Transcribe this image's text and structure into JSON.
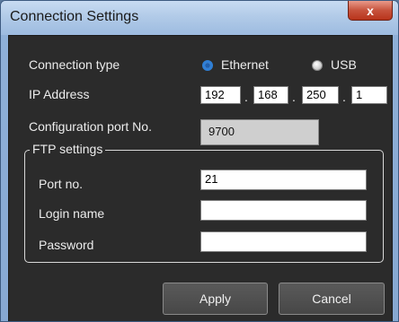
{
  "window": {
    "title": "Connection Settings",
    "close_glyph": "x"
  },
  "connection": {
    "label": "Connection type",
    "options": [
      {
        "label": "Ethernet",
        "selected": true
      },
      {
        "label": "USB",
        "selected": false
      }
    ]
  },
  "ip": {
    "label": "IP Address",
    "octets": [
      "192",
      "168",
      "250",
      "1"
    ],
    "separator": "."
  },
  "config_port": {
    "label": "Configuration port No.",
    "value": "9700"
  },
  "ftp": {
    "title": "FTP settings",
    "port_label": "Port no.",
    "port_value": "21",
    "login_label": "Login name",
    "login_value": "",
    "password_label": "Password",
    "password_value": ""
  },
  "buttons": {
    "apply": "Apply",
    "cancel": "Cancel"
  },
  "colors": {
    "dialog_bg": "#2b2b2b",
    "titlebar": "#b2cbe8",
    "radio_selected": "#2f7fd6",
    "close_red": "#c7533d"
  }
}
